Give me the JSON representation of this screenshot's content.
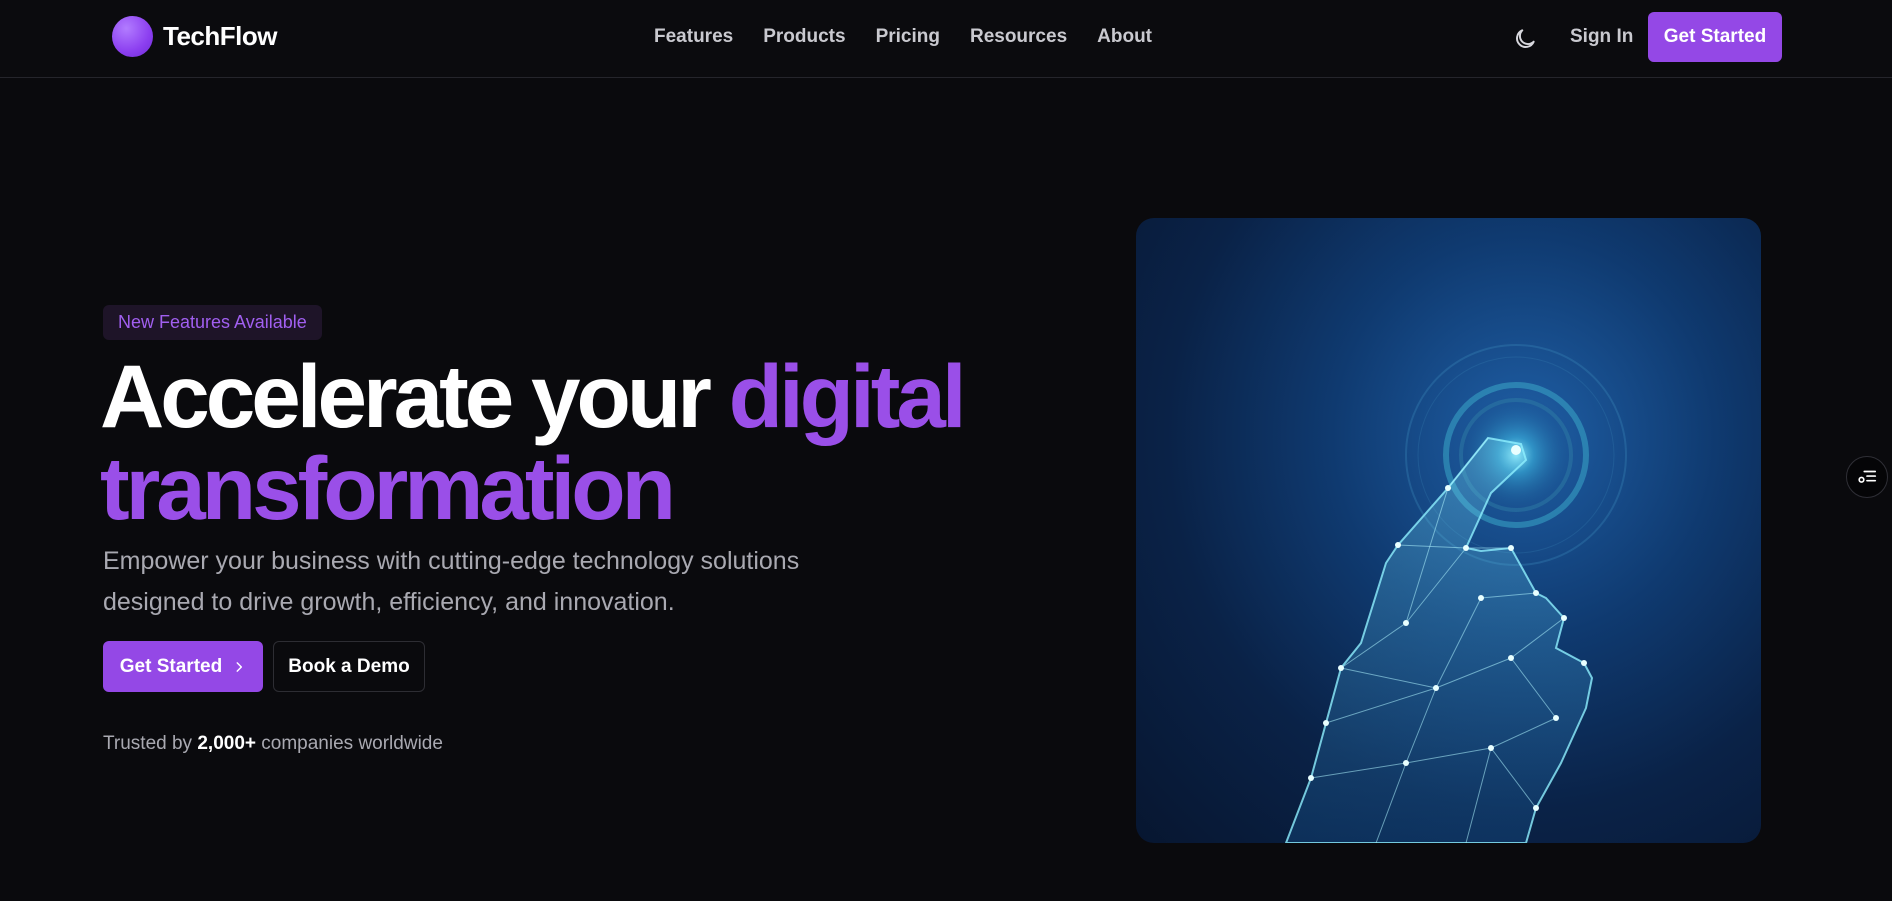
{
  "brand": {
    "name": "TechFlow",
    "accent": "#9448e6"
  },
  "nav": {
    "items": [
      "Features",
      "Products",
      "Pricing",
      "Resources",
      "About"
    ]
  },
  "header": {
    "theme_icon": "moon-icon",
    "sign_in": "Sign In",
    "cta": "Get Started"
  },
  "hero": {
    "badge": "New Features Available",
    "headline_white": "Accelerate your ",
    "headline_accent": "digital transformation",
    "subtitle": "Empower your business with cutting-edge technology solutions designed to drive growth, efficiency, and innovation.",
    "primary_cta": "Get Started",
    "primary_cta_icon": "chevron-right-icon",
    "secondary_cta": "Book a Demo",
    "trusted_prefix": "Trusted by ",
    "trusted_count": "2,000+",
    "trusted_suffix": " companies worldwide",
    "image_icon": "digital-hand-illustration"
  },
  "floating": {
    "icon": "filter-list-icon"
  }
}
